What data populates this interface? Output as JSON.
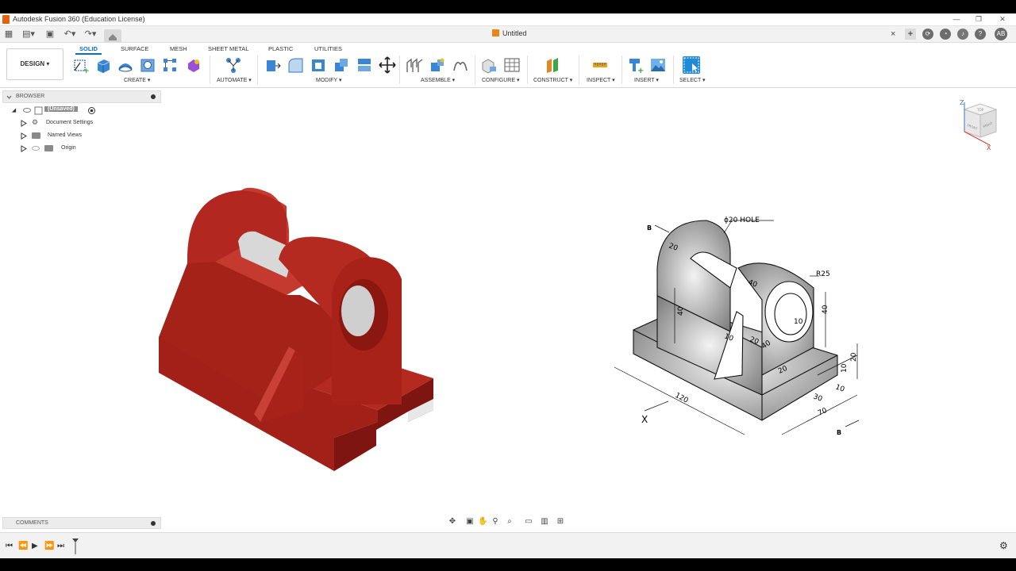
{
  "window": {
    "title": "Autodesk Fusion 360 (Education License)"
  },
  "document": {
    "tab_title": "Untitled",
    "close": "×",
    "user_initials": "AB"
  },
  "workspace": {
    "label": "DESIGN ▾"
  },
  "ribbon": {
    "tabs": [
      "SOLID",
      "SURFACE",
      "MESH",
      "SHEET METAL",
      "PLASTIC",
      "UTILITIES"
    ],
    "active_tab": "SOLID",
    "groups": [
      "CREATE ▾",
      "AUTOMATE ▾",
      "MODIFY ▾",
      "ASSEMBLE ▾",
      "CONFIGURE ▾",
      "CONSTRUCT ▾",
      "INSPECT ▾",
      "INSERT ▾",
      "SELECT ▾"
    ]
  },
  "browser": {
    "title": "BROWSER",
    "root": "(Unsaved)",
    "items": [
      "Document Settings",
      "Named Views",
      "Origin"
    ]
  },
  "comments": {
    "title": "COMMENTS"
  },
  "viewcube": {
    "axis_z": "Z",
    "axis_x": "X",
    "top": "TOP",
    "front": "FRONT",
    "right": "RIGHT"
  },
  "drawing": {
    "labels": {
      "hole": "ϕ20 HOLE",
      "radius": "R25",
      "section_b_top": "B",
      "section_b_bottom": "B",
      "view_x": "X",
      "dim_20_top": "20",
      "dim_40_top": "40",
      "dim_40_left": "40",
      "dim_40_right": "40",
      "dim_10_hole": "10",
      "dim_10_rib": "10",
      "dim_20_rib": "20",
      "dim_40_base": "40",
      "dim_20_base": "20",
      "dim_10_slot": "10",
      "dim_20_slot": "20",
      "dim_30": "30",
      "dim_10_bottom": "10",
      "dim_120": "120",
      "dim_70": "70"
    }
  },
  "colors": {
    "model_front": "#b0231c",
    "model_side": "#8e1a14",
    "model_top": "#c83a2e",
    "accent": "#0c6cd6"
  }
}
